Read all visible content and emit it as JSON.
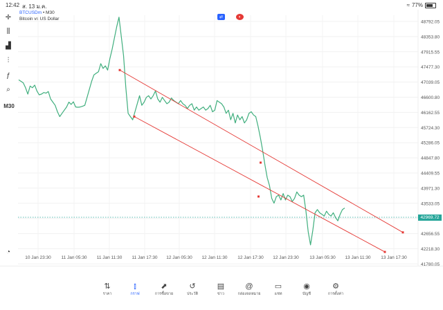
{
  "status_bar": {
    "time": "12:42",
    "date": "ส. 13 ม.ค.",
    "battery": "77%"
  },
  "symbol": {
    "name": "BTCUSDm",
    "separator": "•",
    "timeframe": "M30",
    "description": "Bitcoin vs US Dollar"
  },
  "left_toolbar": {
    "items": [
      {
        "name": "crosshair-icon",
        "glyph": "✛"
      },
      {
        "name": "candles-icon",
        "glyph": "⫼"
      },
      {
        "name": "indicators-icon",
        "glyph": "▟"
      },
      {
        "name": "settings-sliders-icon",
        "glyph": "⫶"
      },
      {
        "name": "function-icon",
        "glyph": "ƒ"
      },
      {
        "name": "shapes-icon",
        "glyph": "⌕"
      }
    ],
    "timeframe_label": "M30"
  },
  "price_axis": {
    "labels": [
      "48792.05",
      "48353.80",
      "47915.55",
      "47477.30",
      "47039.05",
      "46600.80",
      "46162.55",
      "45724.30",
      "45286.05",
      "44847.80",
      "44409.55",
      "43971.30",
      "43533.05",
      "43094.80",
      "42656.55",
      "42218.30",
      "41780.05"
    ]
  },
  "current_price": "42969.72",
  "time_axis": {
    "labels": [
      "10 Jan 23:30",
      "11 Jan 05:30",
      "11 Jan 11:30",
      "11 Jan 17:30",
      "12 Jan 05:30",
      "12 Jan 11:30",
      "12 Jan 17:30",
      "12 Jan 23:30",
      "13 Jan 05:30",
      "13 Jan 11:30",
      "13 Jan 17:30"
    ]
  },
  "colors": {
    "line": "#3fae7d",
    "channel": "#e53935",
    "accent": "#2962ff",
    "price_tag": "#26a69a",
    "dotted": "#26a69a"
  },
  "tabs": [
    {
      "name": "tab-quotes",
      "label": "ราคา",
      "icon": "⇅",
      "active": false
    },
    {
      "name": "tab-chart",
      "label": "กราฟ",
      "icon": "⫾",
      "active": true
    },
    {
      "name": "tab-trade",
      "label": "การซื้อขาย",
      "icon": "⬈",
      "active": false
    },
    {
      "name": "tab-history",
      "label": "ประวัติ",
      "icon": "↺",
      "active": false
    },
    {
      "name": "tab-news",
      "label": "ข่าว",
      "icon": "▤",
      "active": false
    },
    {
      "name": "tab-mailbox",
      "label": "กล่องจดหมาย",
      "icon": "@",
      "active": false
    },
    {
      "name": "tab-chat",
      "label": "แชท",
      "icon": "▭",
      "active": false
    },
    {
      "name": "tab-account",
      "label": "บัญชี",
      "icon": "◉",
      "active": false
    },
    {
      "name": "tab-settings",
      "label": "การตั้งค่า",
      "icon": "⚙",
      "active": false
    }
  ],
  "chart_data": {
    "type": "line",
    "series": [
      {
        "values": [
          46945,
          46900,
          46850,
          46700,
          46500,
          46750,
          46700,
          46780,
          46600,
          46480,
          46500,
          46550,
          46530,
          46580,
          46350,
          46250,
          46150,
          45950,
          45800,
          45900,
          46000,
          46100,
          46250,
          46180,
          46260,
          46100,
          46090,
          46100,
          46120,
          46150,
          46400,
          46650,
          46900,
          47100,
          47150,
          47200,
          47450,
          47300,
          47380,
          47250,
          47600,
          47900,
          48250,
          48600,
          48900,
          48300,
          47700,
          46700,
          45900,
          45800,
          45700,
          45950,
          46200,
          46450,
          46150,
          46250,
          46400,
          46450,
          46350,
          46450,
          46600,
          46350,
          46250,
          46400,
          46300,
          46200,
          46250,
          46380,
          46300,
          46250,
          46200,
          46300,
          46200,
          46150,
          46050,
          46150,
          46200,
          46000,
          46100,
          46000,
          46050,
          46100,
          46000,
          46050,
          46150,
          45950,
          46000,
          46300,
          46250,
          46200,
          46100,
          45900,
          46000,
          45700,
          45900,
          45600,
          45850,
          45700,
          45800,
          45600,
          45700,
          45900,
          45950,
          45850,
          45800,
          45500,
          45150,
          44750,
          44300,
          43900,
          43650,
          43250,
          43100,
          43300,
          43350,
          43200,
          43400,
          43200,
          43350,
          43300,
          43150,
          43250,
          43450,
          43350,
          43300,
          43350,
          42850,
          42200,
          41800,
          42250,
          42800,
          42900,
          42800,
          42750,
          42700,
          42850,
          42750,
          42700,
          42800,
          42650,
          42550,
          42750,
          42900,
          42950
        ]
      }
    ],
    "trendlines": [
      {
        "from": [
          173,
          47250
        ],
        "to": [
          582,
          42190
        ]
      },
      {
        "from": [
          194,
          45800
        ],
        "to": [
          556,
          41580
        ]
      }
    ],
    "ylim": [
      41560,
      48960
    ],
    "xlabels": [
      "10 Jan 23:30",
      "11 Jan 05:30",
      "11 Jan 11:30",
      "11 Jan 17:30",
      "12 Jan 05:30",
      "12 Jan 11:30",
      "12 Jan 17:30",
      "12 Jan 23:30",
      "13 Jan 05:30",
      "13 Jan 11:30",
      "13 Jan 17:30"
    ]
  }
}
